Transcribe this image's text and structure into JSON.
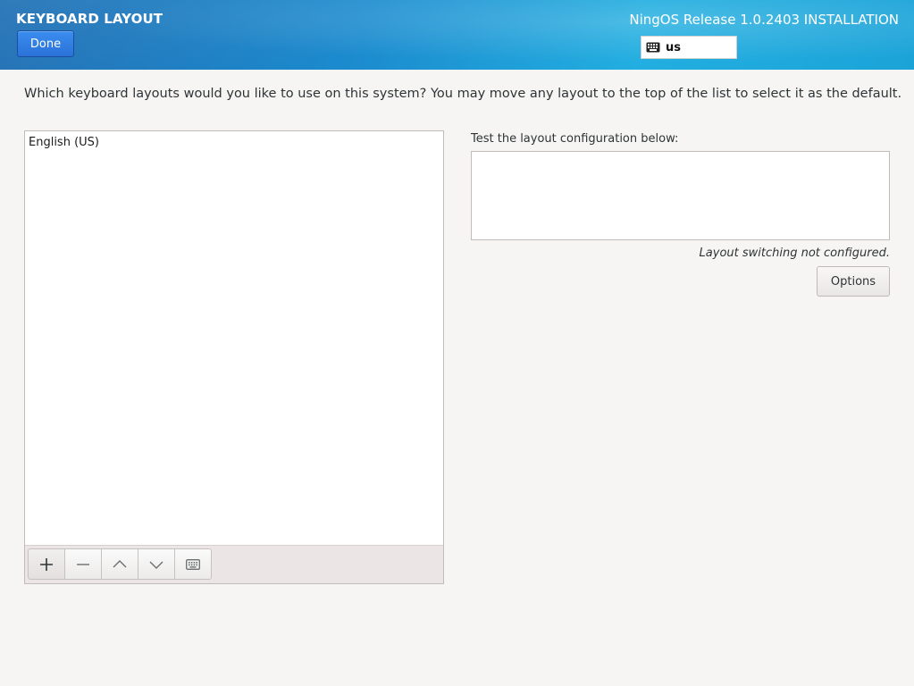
{
  "header": {
    "title": "KEYBOARD LAYOUT",
    "done_label": "Done",
    "release": "NingOS Release 1.0.2403 INSTALLATION",
    "layout_indicator": {
      "icon": "keyboard-icon",
      "code": "us"
    }
  },
  "main": {
    "instructions": "Which keyboard layouts would you like to use on this system?  You may move any layout to the top of the list to select it as the default.",
    "layouts": [
      {
        "label": "English (US)"
      }
    ],
    "toolbar": [
      {
        "name": "add-layout-button",
        "icon": "plus-icon"
      },
      {
        "name": "remove-layout-button",
        "icon": "minus-icon"
      },
      {
        "name": "move-up-button",
        "icon": "chevron-up-icon"
      },
      {
        "name": "move-down-button",
        "icon": "chevron-down-icon"
      },
      {
        "name": "preview-layout-button",
        "icon": "keyboard-icon"
      }
    ],
    "test_label": "Test the layout configuration below:",
    "test_value": "",
    "switch_status": "Layout switching not configured.",
    "options_label": "Options"
  },
  "colors": {
    "header_start": "#1f6fb4",
    "header_end": "#22aee0",
    "done_button": "#2a72d8",
    "background": "#f6f5f4"
  }
}
